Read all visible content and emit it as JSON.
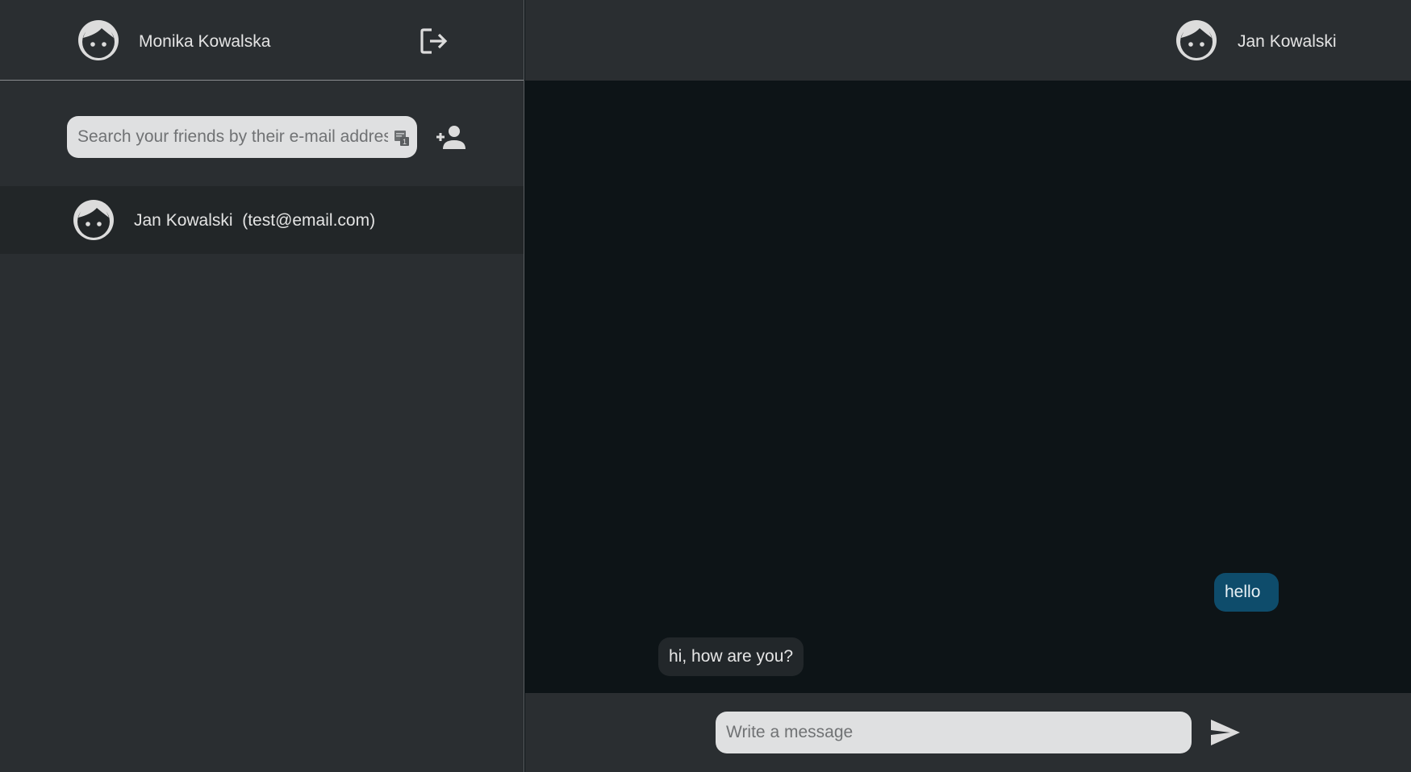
{
  "sidebar": {
    "header": {
      "user_name": "Monika Kowalska",
      "avatar_icon": "face-icon",
      "logout_icon": "logout-icon"
    },
    "search": {
      "placeholder": "Search your friends by their e-mail address",
      "value": "",
      "add_friend_icon": "person-add-icon"
    },
    "friends": [
      {
        "name": "Jan Kowalski",
        "email": "(test@email.com)",
        "label": "Jan Kowalski  (test@email.com)",
        "avatar_icon": "face-icon",
        "selected": true
      }
    ]
  },
  "chat": {
    "header": {
      "peer_name": "Jan Kowalski",
      "avatar_icon": "face-icon"
    },
    "messages": [
      {
        "direction": "outgoing",
        "text": "hello"
      },
      {
        "direction": "incoming",
        "text": "hi, how are you?"
      }
    ],
    "composer": {
      "placeholder": "Write a message",
      "value": "",
      "send_icon": "send-icon"
    }
  },
  "colors": {
    "sidebar_bg": "#2a2e31",
    "chat_bg": "#0d1417",
    "selected_row_bg": "#222628",
    "outgoing_bubble": "#0e4c6b",
    "incoming_bubble": "#22272a",
    "input_bg": "#dfe0e1",
    "icon_color": "#dcdcdc"
  }
}
